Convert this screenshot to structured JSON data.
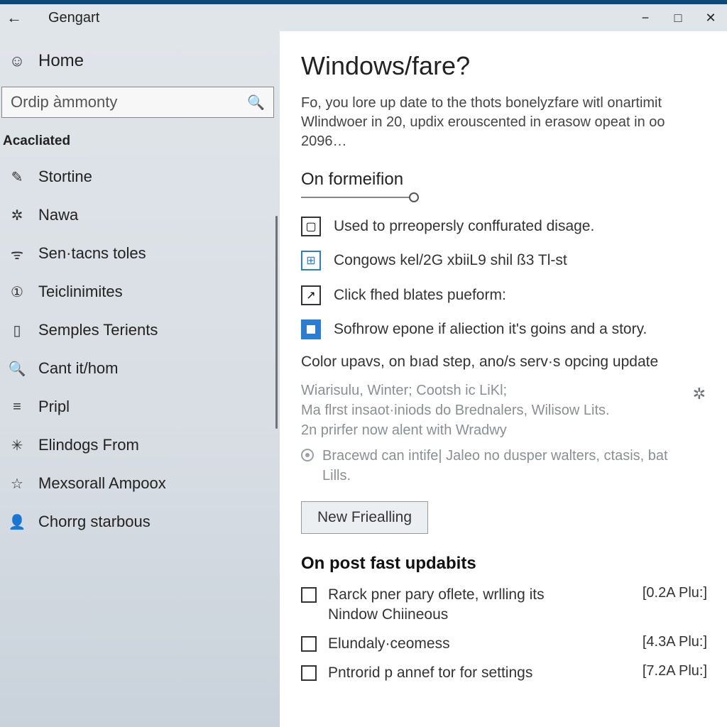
{
  "titlebar": {
    "title": "Gengart"
  },
  "sidebar": {
    "home": "Home",
    "search_placeholder": "Ordip àmmonty",
    "section": "Acacliated",
    "items": [
      {
        "label": "Stortine",
        "icon": "✎"
      },
      {
        "label": "Nawa",
        "icon": "✲"
      },
      {
        "label": "Sen·tacns toles",
        "icon": "ᯤ"
      },
      {
        "label": "Teiclinimites",
        "icon": "①"
      },
      {
        "label": "Semples Terients",
        "icon": "▯"
      },
      {
        "label": "Cant it/hom",
        "icon": "🔍"
      },
      {
        "label": "Pripl",
        "icon": "≡"
      },
      {
        "label": "Elindogs From",
        "icon": "✳"
      },
      {
        "label": "Mexsorall Ampoox",
        "icon": "☆"
      },
      {
        "label": "Chorrg starbous",
        "icon": "👤"
      }
    ]
  },
  "content": {
    "heading": "Windows/fare?",
    "intro": "Fo, you lore up date to the thots bonelyzfare witl onartimit Wlindwoer in 20, updix erouscented in erasow opeat in oo 2096…",
    "section1": "On formeifion",
    "options": [
      "Used to prreopersly conffurated disage.",
      "Congows kel/2G xbiiL9 shil ß3 Tl-st",
      "Click fhed blates pueform:",
      "Sofhrow epone if aliection it's goins and a story."
    ],
    "sub_h": "Color upavs, on bıad step, ano/s serv·s opcing update",
    "gray1": "Wiarisulu, Winter; Cootsh ic LiKl;\nMa flrst insaot·iniods do Brednalers, Wilisow Lits.\n2n prirfer now alent with Wradwy",
    "gray2": "Bracewd can intife| Jaleo no dusper walters, ctasis, bat Lills.",
    "button": "New Friealling",
    "section2": "On post fast updabits",
    "checks": [
      {
        "label": "Rarck pner pary oflete, wrlling its Nindow Chiineous",
        "meta": "[0.2A Plu:]"
      },
      {
        "label": "Elundaly·ceomess",
        "meta": "[4.3A Plu:]"
      },
      {
        "label": "Pntrorid p annef tor for settings",
        "meta": "[7.2A Plu:]"
      }
    ]
  }
}
